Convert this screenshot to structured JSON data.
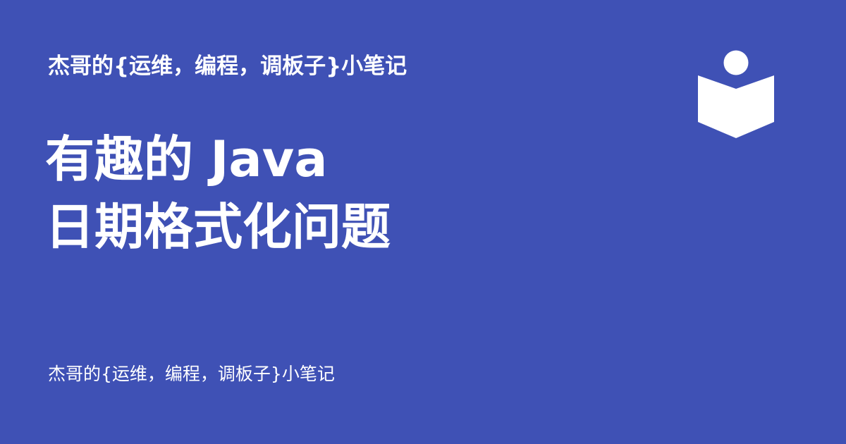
{
  "brand": {
    "site_name": "杰哥的{运维，编程，调板子}小笔记",
    "logo_icon": "open-book-reader-icon",
    "background_color": "#3f51b5",
    "foreground_color": "#ffffff"
  },
  "article": {
    "title_line_1": "有趣的 Java",
    "title_line_2": "日期格式化问题"
  },
  "footer": {
    "site_name": "杰哥的{运维，编程，调板子}小笔记"
  }
}
